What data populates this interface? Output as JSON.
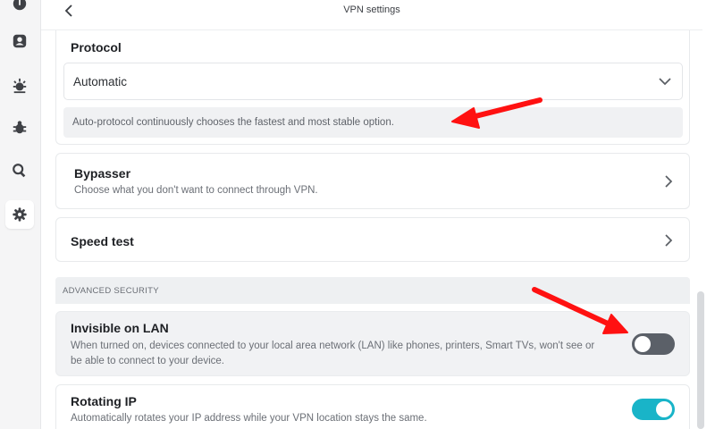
{
  "header": {
    "title": "VPN settings"
  },
  "sidebar": {
    "items": [
      {
        "icon": "shield-icon"
      },
      {
        "icon": "account-icon"
      },
      {
        "icon": "threat-protection-icon"
      },
      {
        "icon": "bug-icon"
      },
      {
        "icon": "search-icon"
      },
      {
        "icon": "gear-icon",
        "active": true
      }
    ]
  },
  "protocol": {
    "title": "Protocol",
    "selected": "Automatic",
    "note": "Auto-protocol continuously chooses the fastest and most stable option."
  },
  "bypasser": {
    "title": "Bypasser",
    "description": "Choose what you don't want to connect through VPN."
  },
  "speed_test": {
    "title": "Speed test"
  },
  "advanced_security": {
    "header": "ADVANCED SECURITY",
    "invisible_lan": {
      "title": "Invisible on LAN",
      "description": "When turned on, devices connected to your local area network (LAN) like phones, printers, Smart TVs, won't see or be able to connect to your device.",
      "enabled": false
    },
    "rotating_ip": {
      "title": "Rotating IP",
      "description": "Automatically rotates your IP address while your VPN location stays the same.",
      "enabled": true
    }
  },
  "colors": {
    "accent": "#19b4c8",
    "toggle_off": "#5b6068",
    "annotation_arrow": "#ff1111"
  }
}
